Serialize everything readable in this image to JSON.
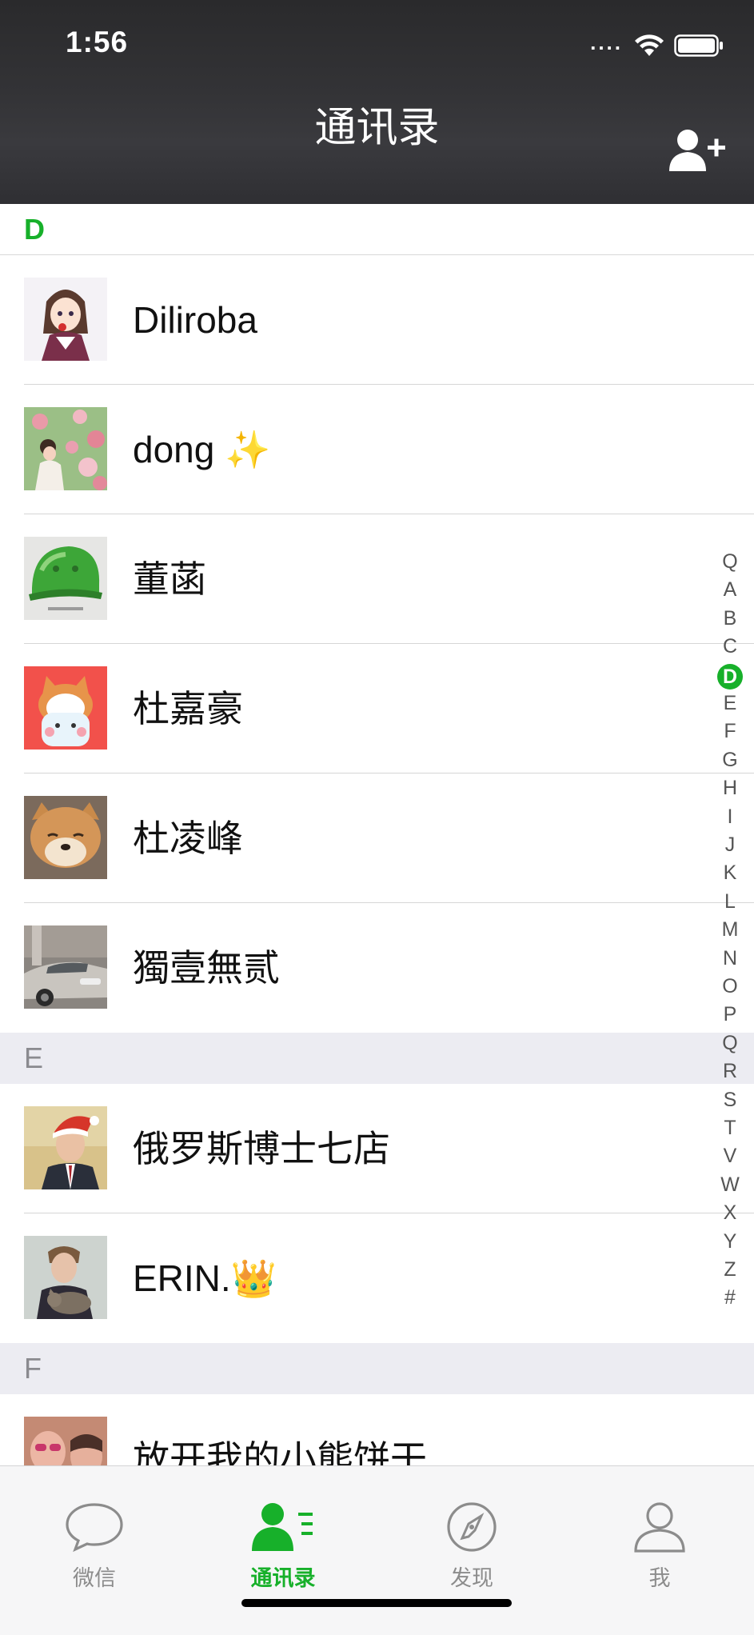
{
  "status_bar": {
    "time": "1:56",
    "signal": "...."
  },
  "nav": {
    "title": "通讯录",
    "add_friend_icon": "person-plus-icon"
  },
  "sections": [
    {
      "letter": "D",
      "contacts": [
        {
          "name": "Diliroba",
          "avatar": "anime-girl-avatar"
        },
        {
          "name": "dong ✨",
          "avatar": "flowers-girl-avatar"
        },
        {
          "name": "董菡",
          "avatar": "green-helmet-avatar"
        },
        {
          "name": "杜嘉豪",
          "avatar": "shiba-cartoon-avatar"
        },
        {
          "name": "杜凌峰",
          "avatar": "shiba-dog-avatar"
        },
        {
          "name": "獨壹無贰",
          "avatar": "car-avatar"
        }
      ]
    },
    {
      "letter": "E",
      "contacts": [
        {
          "name": "俄罗斯博士七店",
          "avatar": "man-santa-hat-avatar"
        },
        {
          "name": "ERIN.👑",
          "avatar": "man-with-cat-avatar"
        }
      ]
    },
    {
      "letter": "F",
      "contacts": [
        {
          "name": "放开我的小熊饼干",
          "avatar": "two-people-avatar"
        }
      ]
    }
  ],
  "index_bar": {
    "letters": [
      "Q",
      "A",
      "B",
      "C",
      "D",
      "E",
      "F",
      "G",
      "H",
      "I",
      "J",
      "K",
      "L",
      "M",
      "N",
      "O",
      "P",
      "Q",
      "R",
      "S",
      "T",
      "V",
      "W",
      "X",
      "Y",
      "Z",
      "#"
    ],
    "active": "D",
    "extra_letters": [
      "X",
      "Y",
      "Z",
      "#"
    ]
  },
  "tabs": [
    {
      "label": "微信",
      "icon": "chat-bubble-icon",
      "active": false
    },
    {
      "label": "通讯录",
      "icon": "contacts-icon",
      "active": true
    },
    {
      "label": "发现",
      "icon": "compass-icon",
      "active": false
    },
    {
      "label": "我",
      "icon": "person-icon",
      "active": false
    }
  ],
  "colors": {
    "accent": "#17b02a",
    "nav_bg": "#333336",
    "section_bg": "#ececf2"
  }
}
